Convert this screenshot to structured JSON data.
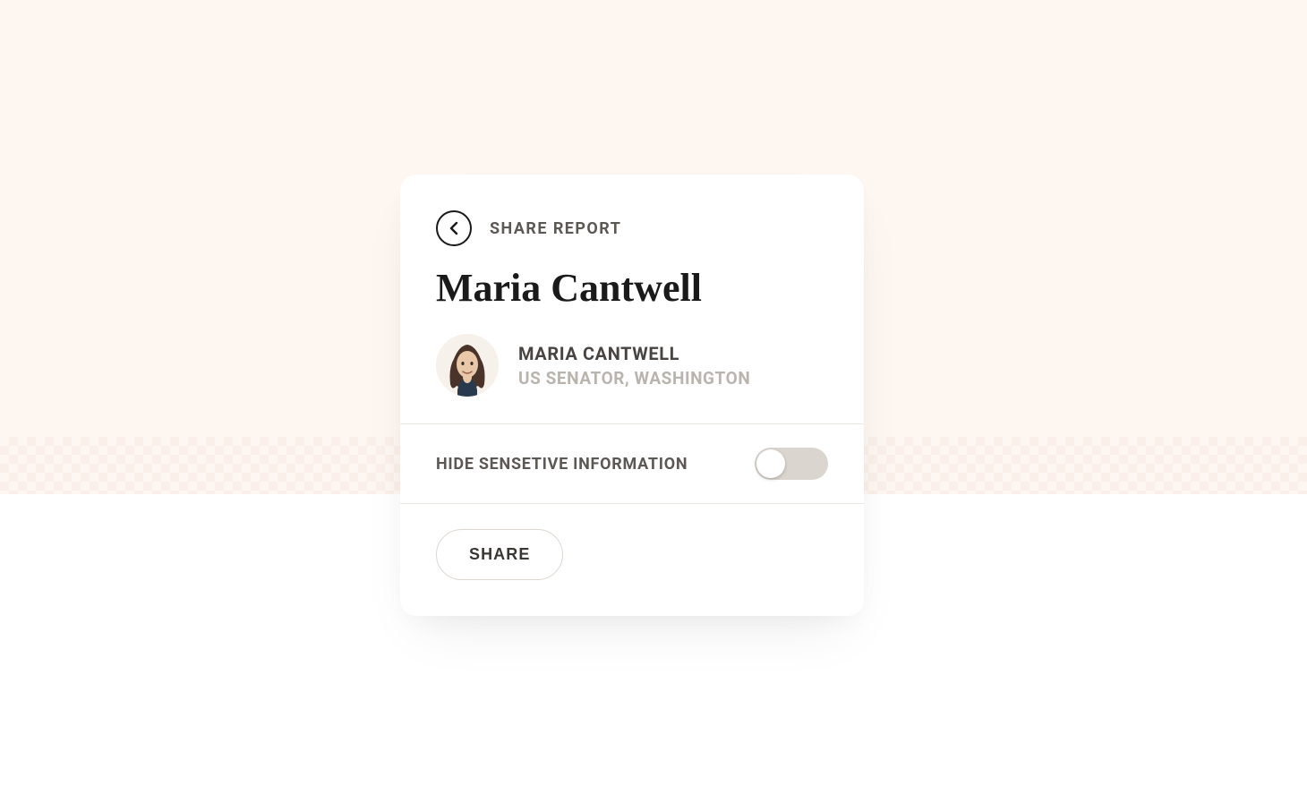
{
  "header": {
    "label": "SHARE REPORT"
  },
  "person": {
    "displayName": "Maria Cantwell",
    "nameUpper": "MARIA CANTWELL",
    "title": "US SENATOR, WASHINGTON"
  },
  "toggle": {
    "label": "HIDE SENSETIVE INFORMATION",
    "on": false
  },
  "actions": {
    "shareLabel": "SHARE"
  }
}
